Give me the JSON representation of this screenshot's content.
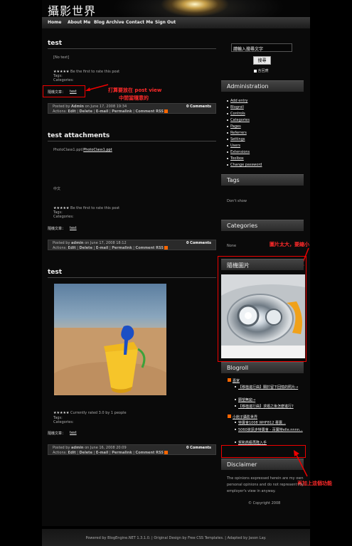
{
  "header": {
    "title": "攝影世界"
  },
  "nav": [
    "Home",
    "About Me",
    "Blog Archive",
    "Contact Me",
    "Sign Out"
  ],
  "posts": [
    {
      "title": "test",
      "body": "[No text]",
      "rating": "Be the first to rate this post",
      "tags": "Tags:",
      "categories": "Categories:",
      "random_label": "隨機文章：",
      "random_link": "test",
      "meta": {
        "posted_by": "Posted by",
        "author": "Admin",
        "date": "on June 17, 2008 19:34",
        "comments": "0 Comments",
        "actions_label": "Actions:",
        "edit": "Edit",
        "delete": "Delete",
        "email": "E-mail",
        "permalink": "Permalink",
        "comment_rss": "Comment RSS"
      }
    },
    {
      "title": "test attachments",
      "attachment_label": "PhotoClass1.ppt",
      "attachment_link": "PhotoClass1.ppt",
      "text": "中文",
      "rating": "Be the first to rate this post",
      "tags": "Tags:",
      "categories": "Categories:",
      "random_label": "隨機文章：",
      "random_link": "test",
      "meta": {
        "posted_by": "Posted by",
        "author": "admin",
        "date": "on June 17, 2008 18:12",
        "comments": "0 Comments",
        "actions_label": "Actions:",
        "edit": "Edit",
        "delete": "Delete",
        "email": "E-mail",
        "permalink": "Permalink",
        "comment_rss": "Comment RSS"
      }
    },
    {
      "title": "test",
      "rating": "Currently rated 3.0 by 1 people",
      "tags": "Tags:",
      "categories": "Categories:",
      "random_label": "隨機文章：",
      "random_link": "test",
      "meta": {
        "posted_by": "Posted by",
        "author": "admin",
        "date": "on June 16, 2008 20:09",
        "comments": "0 Comments",
        "actions_label": "Actions:",
        "edit": "Edit",
        "delete": "Delete",
        "email": "E-mail",
        "permalink": "Permalink",
        "comment_rss": "Comment RSS"
      }
    }
  ],
  "annotations": {
    "note1_line1": "打算要放在 post view",
    "note1_line2": "中間當隨意的",
    "note2": "圖片太大，要縮小",
    "note3": "再加上這個功能"
  },
  "sidebar": {
    "search_title": "請輸入搜尋文字",
    "search_button": "搜尋",
    "search_comments": "含回應",
    "admin_title": "Administration",
    "admin_links": [
      "Add entry",
      "Blogroll",
      "Controls",
      "Categories",
      "Pages",
      "Referrers",
      "Settings",
      "Users",
      "Extensions",
      "Toolbox",
      "Change password"
    ],
    "tags_title": "Tags",
    "tags_none": "Don't show",
    "categories_title": "Categories",
    "categories_none": "None",
    "random_image_title": "隨機圖片",
    "blogroll_title": "Blogroll",
    "blogroll_groups": [
      {
        "name": "嘉家",
        "items": [
          "【移植進行曲】關於留下回憶的照片→",
          "願望無窮→",
          "【移植進行曲】求婚之後怎麼進行?"
        ]
      },
      {
        "name": "小館子攝影世界",
        "items": [
          "特賣會1008 WHF812 專賣...",
          "5060資訊步特賣會 - 百厲特elle.nnnn...",
          "賀和高級再隆入手"
        ]
      }
    ],
    "disclaimer_title": "Disclaimer",
    "disclaimer_text": [
      "The opinions expressed herein are my own",
      "personal opinions and do not represent my",
      "employer's view in anyway."
    ],
    "copyright": "© Copyright 2008"
  },
  "footer": {
    "text": "Powered by BlogEngine.NET 1.3.1.0. | Original Design by Free CSS Templates. | Adapted by Jason Lay."
  },
  "colors": {
    "background": "#000000",
    "annotation_red": "#ee0000",
    "link": "#e8e8e8"
  }
}
